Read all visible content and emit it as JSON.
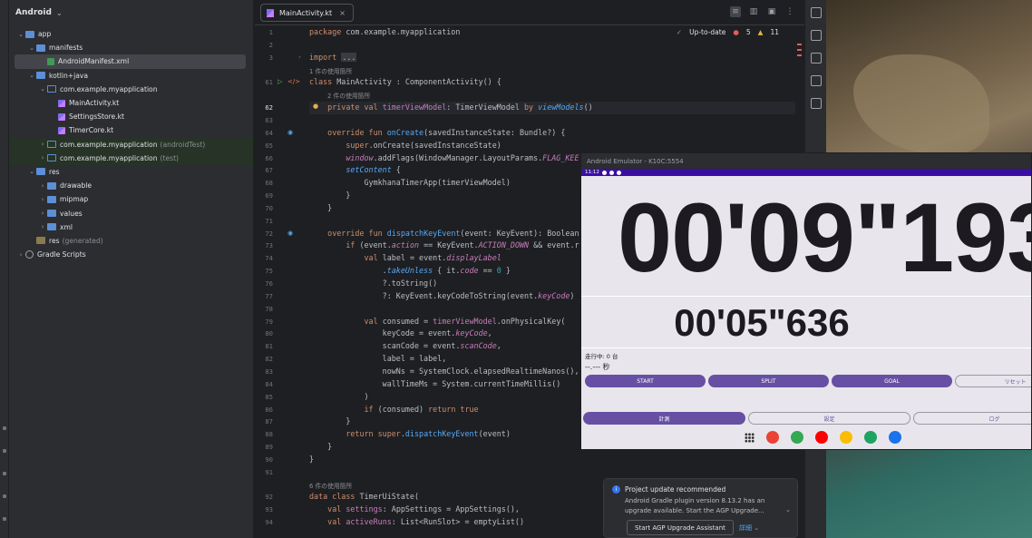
{
  "project": {
    "title": "Android",
    "tree": [
      {
        "label": "app",
        "indent": 0,
        "arrow": "open",
        "icon": "folder"
      },
      {
        "label": "manifests",
        "indent": 1,
        "arrow": "open",
        "icon": "folder"
      },
      {
        "label": "AndroidManifest.xml",
        "indent": 2,
        "arrow": "",
        "icon": "xml",
        "selected": true
      },
      {
        "label": "kotlin+java",
        "indent": 1,
        "arrow": "open",
        "icon": "folder"
      },
      {
        "label": "com.example.myapplication",
        "indent": 2,
        "arrow": "open",
        "icon": "pkg"
      },
      {
        "label": "MainActivity.kt",
        "indent": 3,
        "arrow": "",
        "icon": "kt"
      },
      {
        "label": "SettingsStore.kt",
        "indent": 3,
        "arrow": "",
        "icon": "kt"
      },
      {
        "label": "TimerCore.kt",
        "indent": 3,
        "arrow": "",
        "icon": "kt"
      },
      {
        "label": "com.example.myapplication",
        "suffix": "(androidTest)",
        "indent": 2,
        "arrow": "closed",
        "icon": "pkg",
        "highlight": true
      },
      {
        "label": "com.example.myapplication",
        "suffix": "(test)",
        "indent": 2,
        "arrow": "closed",
        "icon": "pkg",
        "highlight": true
      },
      {
        "label": "res",
        "indent": 1,
        "arrow": "open",
        "icon": "folder"
      },
      {
        "label": "drawable",
        "indent": 2,
        "arrow": "closed",
        "icon": "folder"
      },
      {
        "label": "mipmap",
        "indent": 2,
        "arrow": "closed",
        "icon": "folder"
      },
      {
        "label": "values",
        "indent": 2,
        "arrow": "closed",
        "icon": "folder"
      },
      {
        "label": "xml",
        "indent": 2,
        "arrow": "closed",
        "icon": "folder"
      },
      {
        "label": "res",
        "suffix": "(generated)",
        "indent": 1,
        "arrow": "",
        "icon": "res"
      },
      {
        "label": "Gradle Scripts",
        "indent": 0,
        "arrow": "closed",
        "icon": "gradle"
      }
    ]
  },
  "editor": {
    "tab_label": "MainActivity.kt",
    "tab_close": "×",
    "status": {
      "uptodate": "Up-to-date",
      "errors": "5",
      "warnings": "11"
    },
    "lines": [
      {
        "n": "1",
        "html": "<span class=\"kw\">package</span> com.example.myapplication"
      },
      {
        "n": "2",
        "html": ""
      },
      {
        "n": "3",
        "html": "<span class=\"kw\">import</span> <span class=\"dim\">...</span>",
        "fold": true
      },
      {
        "n": "",
        "hint": "1 件の使用箇所"
      },
      {
        "n": "61",
        "html": "<span class=\"kw\">class</span> MainActivity : ComponentActivity() {",
        "run": true
      },
      {
        "n": "",
        "hint": "2 件の使用箇所",
        "hint_indent": 1
      },
      {
        "n": "62",
        "html": "    <span class=\"kw\">private val</span> <span class=\"prop\">timerViewModel</span>: TimerViewModel <span class=\"kw\">by</span> <span class=\"fn it\">viewModels</span>()",
        "current": true,
        "bulb": true
      },
      {
        "n": "63",
        "html": ""
      },
      {
        "n": "64",
        "html": "    <span class=\"kw\">override fun</span> <span class=\"fn\">onCreate</span>(savedInstanceState: Bundle?) {",
        "override": true
      },
      {
        "n": "65",
        "html": "        <span class=\"kw\">super</span>.onCreate(savedInstanceState)"
      },
      {
        "n": "66",
        "html": "        <span class=\"prop it\">window</span>.addFlags(WindowManager.LayoutParams.<span class=\"prop it\">FLAG_KEE</span>"
      },
      {
        "n": "67",
        "html": "        <span class=\"fn it\">setContent</span> {"
      },
      {
        "n": "68",
        "html": "            GymkhanaTimerApp(timerViewModel)"
      },
      {
        "n": "69",
        "html": "        }"
      },
      {
        "n": "70",
        "html": "    }"
      },
      {
        "n": "71",
        "html": ""
      },
      {
        "n": "72",
        "html": "    <span class=\"kw\">override fun</span> <span class=\"fn\">dispatchKeyEvent</span>(event: KeyEvent): Boolean",
        "override": true
      },
      {
        "n": "73",
        "html": "        <span class=\"kw\">if</span> (event.<span class=\"prop it\">action</span> == KeyEvent.<span class=\"prop it\">ACTION_DOWN</span> &amp;&amp; event.r"
      },
      {
        "n": "74",
        "html": "            <span class=\"kw\">val</span> label = event.<span class=\"prop it\">displayLabel</span>"
      },
      {
        "n": "75",
        "html": "                .<span class=\"fn it\">takeUnless</span> { it.<span class=\"prop it\">code</span> == <span class=\"num\">0</span> }"
      },
      {
        "n": "76",
        "html": "                ?.toString()"
      },
      {
        "n": "77",
        "html": "                ?: KeyEvent.keyCodeToString(event.<span class=\"prop it\">keyCode</span>)"
      },
      {
        "n": "78",
        "html": ""
      },
      {
        "n": "79",
        "html": "            <span class=\"kw\">val</span> consumed = <span class=\"prop\">timerViewModel</span>.onPhysicalKey("
      },
      {
        "n": "80",
        "html": "                keyCode = event.<span class=\"prop it\">keyCode</span>,"
      },
      {
        "n": "81",
        "html": "                scanCode = event.<span class=\"prop it\">scanCode</span>,"
      },
      {
        "n": "82",
        "html": "                label = label,"
      },
      {
        "n": "83",
        "html": "                nowNs = SystemClock.elapsedRealtimeNanos(),"
      },
      {
        "n": "84",
        "html": "                wallTimeMs = System.currentTimeMillis()"
      },
      {
        "n": "85",
        "html": "            )"
      },
      {
        "n": "86",
        "html": "            <span class=\"kw\">if</span> (consumed) <span class=\"kw\">return true</span>"
      },
      {
        "n": "87",
        "html": "        }"
      },
      {
        "n": "88",
        "html": "        <span class=\"kw\">return super</span>.<span class=\"fn\">dispatchKeyEvent</span>(event)"
      },
      {
        "n": "89",
        "html": "    }"
      },
      {
        "n": "90",
        "html": "}"
      },
      {
        "n": "91",
        "html": ""
      },
      {
        "n": "",
        "hint": "6 件の使用箇所"
      },
      {
        "n": "92",
        "html": "<span class=\"kw\">data class</span> TimerUiState("
      },
      {
        "n": "93",
        "html": "    <span class=\"kw\">val</span> <span class=\"prop\">settings</span>: AppSettings = AppSettings(),"
      },
      {
        "n": "94",
        "html": "    <span class=\"kw\">val</span> <span class=\"prop\">activeRuns</span>: List&lt;RunSlot&gt; = emptyList()"
      }
    ]
  },
  "emulator": {
    "title": "Android Emulator - K10C:5554",
    "clock": "11:12",
    "main_time": "00'09\"193",
    "split_time": "00'05\"636",
    "running_label": "走行中: 0 台",
    "seconds_label": "--.--- 秒",
    "buttons": [
      {
        "label": "START",
        "style": "filled"
      },
      {
        "label": "SPLIT",
        "style": "filled"
      },
      {
        "label": "GOAL",
        "style": "filled"
      },
      {
        "label": "リセット",
        "style": "outline"
      }
    ],
    "nav": [
      {
        "label": "計測",
        "style": "filled"
      },
      {
        "label": "設定",
        "style": "outline"
      },
      {
        "label": "ログ",
        "style": "outline"
      }
    ],
    "dock_colors": [
      "#ea4335",
      "#34a853",
      "#ff0000",
      "#fbbc04",
      "#1ea362",
      "#1a73e8"
    ]
  },
  "notification": {
    "title": "Project update recommended",
    "body": "Android Gradle plugin version 8.13.2 has an upgrade available. Start the AGP Upgrade...",
    "button": "Start AGP Upgrade Assistant",
    "more": "詳細 ⌄"
  }
}
